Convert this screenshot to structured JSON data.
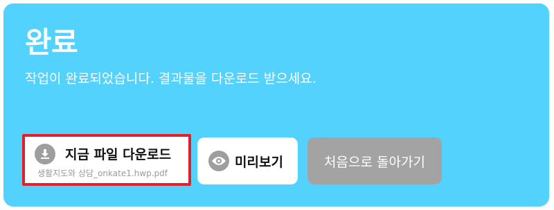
{
  "header": {
    "title": "완료",
    "subtitle": "작업이 완료되었습니다. 결과물을 다운로드 받으세요."
  },
  "actions": {
    "download": {
      "label": "지금 파일 다운로드",
      "filename": "생활지도와 상담_onkate1.hwp.pdf",
      "icon": "download-icon"
    },
    "preview": {
      "label": "미리보기",
      "icon": "eye-icon"
    },
    "restart": {
      "label": "처음으로 돌아가기"
    }
  },
  "colors": {
    "panel_background": "#53d2fd",
    "highlight_border": "#e3202a",
    "icon_circle": "#9e9e9e",
    "restart_button": "#a3a3a3"
  }
}
